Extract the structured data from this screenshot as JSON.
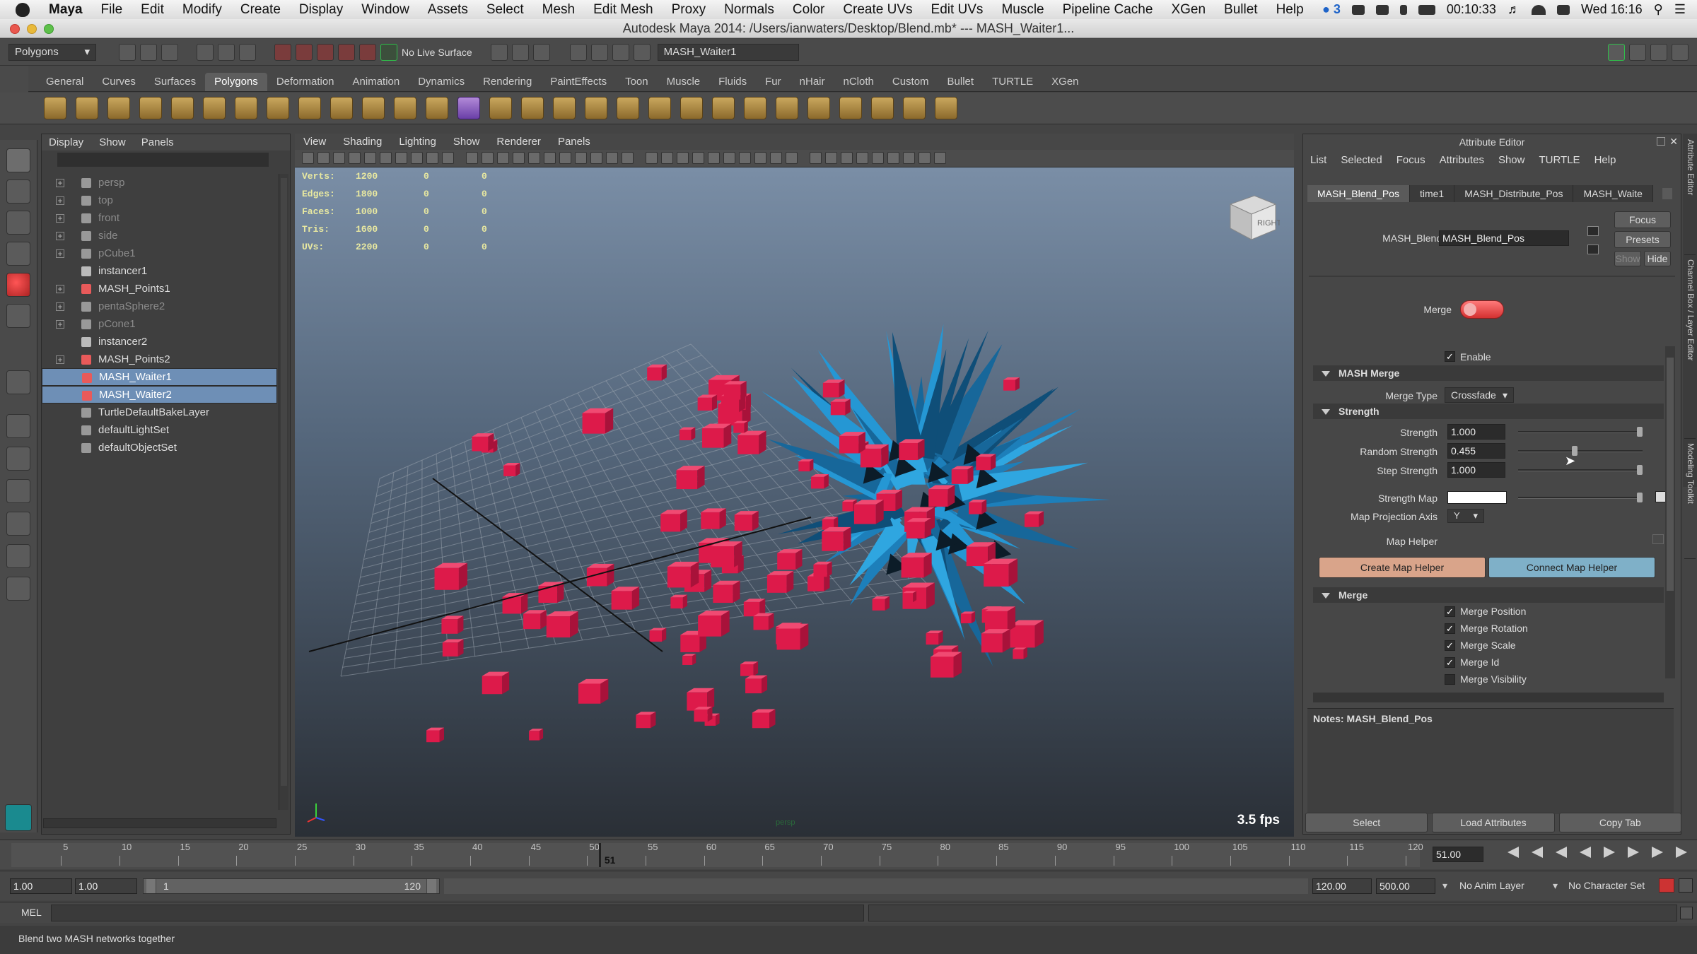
{
  "macbar": {
    "app": "Maya",
    "menus": [
      "File",
      "Edit",
      "Modify",
      "Create",
      "Display",
      "Window",
      "Assets",
      "Select",
      "Mesh",
      "Edit Mesh",
      "Proxy",
      "Normals",
      "Color",
      "Create UVs",
      "Edit UVs",
      "Muscle",
      "Pipeline Cache",
      "XGen",
      "Bullet",
      "Help"
    ],
    "battery_count": "3",
    "time_remaining": "00:10:33",
    "clock": "Wed 16:16"
  },
  "window_title": "Autodesk Maya 2014: /Users/ianwaters/Desktop/Blend.mb*   ---   MASH_Waiter1...",
  "statusline": {
    "menu_set": "Polygons",
    "live_surface": "No Live Surface",
    "name_field": "MASH_Waiter1"
  },
  "shelf_tabs": [
    "General",
    "Curves",
    "Surfaces",
    "Polygons",
    "Deformation",
    "Animation",
    "Dynamics",
    "Rendering",
    "PaintEffects",
    "Toon",
    "Muscle",
    "Fluids",
    "Fur",
    "nHair",
    "nCloth",
    "Custom",
    "Bullet",
    "TURTLE",
    "XGen"
  ],
  "shelf_active": "Polygons",
  "outliner": {
    "menu": [
      "Display",
      "Show",
      "Panels"
    ],
    "items": [
      {
        "label": "persp",
        "dim": true,
        "exp": true
      },
      {
        "label": "top",
        "dim": true,
        "exp": true
      },
      {
        "label": "front",
        "dim": true,
        "exp": true
      },
      {
        "label": "side",
        "dim": true,
        "exp": true
      },
      {
        "label": "pCube1",
        "dim": true,
        "exp": true
      },
      {
        "label": "instancer1",
        "dim": false,
        "exp": false
      },
      {
        "label": "MASH_Points1",
        "dim": false,
        "exp": true
      },
      {
        "label": "pentaSphere2",
        "dim": true,
        "exp": true
      },
      {
        "label": "pCone1",
        "dim": true,
        "exp": true
      },
      {
        "label": "instancer2",
        "dim": false,
        "exp": false
      },
      {
        "label": "MASH_Points2",
        "dim": false,
        "exp": true
      },
      {
        "label": "MASH_Waiter1",
        "dim": false,
        "exp": false,
        "selected": true
      },
      {
        "label": "MASH_Waiter2",
        "dim": false,
        "exp": false,
        "selected": true
      },
      {
        "label": "TurtleDefaultBakeLayer",
        "dim": false,
        "exp": false
      },
      {
        "label": "defaultLightSet",
        "dim": false,
        "exp": false
      },
      {
        "label": "defaultObjectSet",
        "dim": false,
        "exp": false
      }
    ]
  },
  "viewport": {
    "menu": [
      "View",
      "Shading",
      "Lighting",
      "Show",
      "Renderer",
      "Panels"
    ],
    "hud": [
      {
        "k": "Verts:",
        "v": "1200",
        "a": "0",
        "b": "0"
      },
      {
        "k": "Edges:",
        "v": "1800",
        "a": "0",
        "b": "0"
      },
      {
        "k": "Faces:",
        "v": "1000",
        "a": "0",
        "b": "0"
      },
      {
        "k": "Tris:",
        "v": "1600",
        "a": "0",
        "b": "0"
      },
      {
        "k": "UVs:",
        "v": "2200",
        "a": "0",
        "b": "0"
      }
    ],
    "fps": "3.5 fps",
    "camera_label": "persp",
    "viewcube_label": "RIGHT"
  },
  "attribute_editor": {
    "title": "Attribute Editor",
    "menu": [
      "List",
      "Selected",
      "Focus",
      "Attributes",
      "Show",
      "TURTLE",
      "Help"
    ],
    "tabs": [
      "MASH_Blend_Pos",
      "time1",
      "MASH_Distribute_Pos",
      "MASH_Waite"
    ],
    "node_label": "MASH_Blend:",
    "node_value": "MASH_Blend_Pos",
    "focus": "Focus",
    "presets": "Presets",
    "show": "Show",
    "hide": "Hide",
    "merge_toggle_label": "Merge",
    "enable": "Enable",
    "sec_mash_merge": "MASH Merge",
    "merge_type_label": "Merge Type",
    "merge_type_value": "Crossfade",
    "sec_strength": "Strength",
    "strength_label": "Strength",
    "strength_value": "1.000",
    "random_strength_label": "Random Strength",
    "random_strength_value": "0.455",
    "step_strength_label": "Step Strength",
    "step_strength_value": "1.000",
    "strength_map_label": "Strength Map",
    "map_axis_label": "Map Projection Axis",
    "map_axis_value": "Y",
    "map_helper_label": "Map Helper",
    "create_map_helper": "Create Map Helper",
    "connect_map_helper": "Connect Map Helper",
    "sec_merge": "Merge",
    "merge_checks": [
      "Merge Position",
      "Merge Rotation",
      "Merge Scale",
      "Merge Id",
      "Merge Visibility"
    ],
    "notes": "Notes:  MASH_Blend_Pos",
    "select": "Select",
    "load_attributes": "Load Attributes",
    "copy_tab": "Copy Tab",
    "side_tabs": [
      "Attribute Editor",
      "Channel Box / Layer Editor",
      "Modeling Toolkit"
    ]
  },
  "timeline": {
    "ticks": [
      "5",
      "10",
      "15",
      "20",
      "25",
      "30",
      "35",
      "40",
      "45",
      "50",
      "55",
      "60",
      "65",
      "70",
      "75",
      "80",
      "85",
      "90",
      "95",
      "100",
      "105",
      "110",
      "115",
      "120"
    ],
    "current_frame": "51",
    "current_field": "51.00"
  },
  "range": {
    "start": "1.00",
    "playback_start": "1.00",
    "range_min": "1",
    "range_max": "120",
    "playback_end": "120.00",
    "end": "500.00",
    "anim_layer": "No Anim Layer",
    "char_set": "No Character Set"
  },
  "cmdline": {
    "mel": "MEL"
  },
  "help_text": "Blend two MASH networks together",
  "colors": {
    "accent_select": "#6e8fb6",
    "cube_red": "#dd1a4a",
    "spike_blue": "#2597d4",
    "create_btn": "#d9a48a",
    "connect_btn": "#7fb0c8"
  }
}
